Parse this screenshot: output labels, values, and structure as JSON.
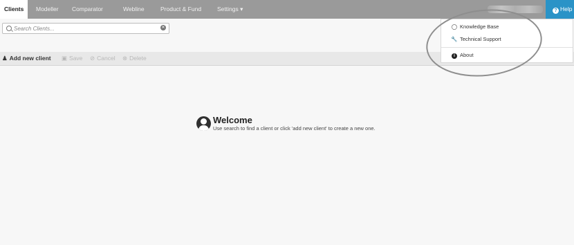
{
  "nav": {
    "tabs": [
      {
        "label": "Clients",
        "active": true
      },
      {
        "label": "Modeller"
      },
      {
        "label": "Comparator"
      },
      {
        "label": "Webline"
      },
      {
        "label": "Product & Fund"
      },
      {
        "label": "Settings ▾"
      }
    ],
    "help_label": "Help",
    "accent_color": "#2a93c7"
  },
  "search": {
    "placeholder": "Search Clients...",
    "value": ""
  },
  "toolbar": {
    "add_new_client": "Add new client",
    "save": "Save",
    "cancel": "Cancel",
    "delete": "Delete"
  },
  "welcome": {
    "title": "Welcome",
    "message": "Use search to find a client or click 'add new client' to create a new one."
  },
  "help_menu": {
    "items": [
      {
        "label": "Knowledge Base",
        "icon": "lightbulb-icon"
      },
      {
        "label": "Technical Support",
        "icon": "wrench-icon"
      },
      {
        "label": "About",
        "icon": "info-icon"
      }
    ]
  }
}
